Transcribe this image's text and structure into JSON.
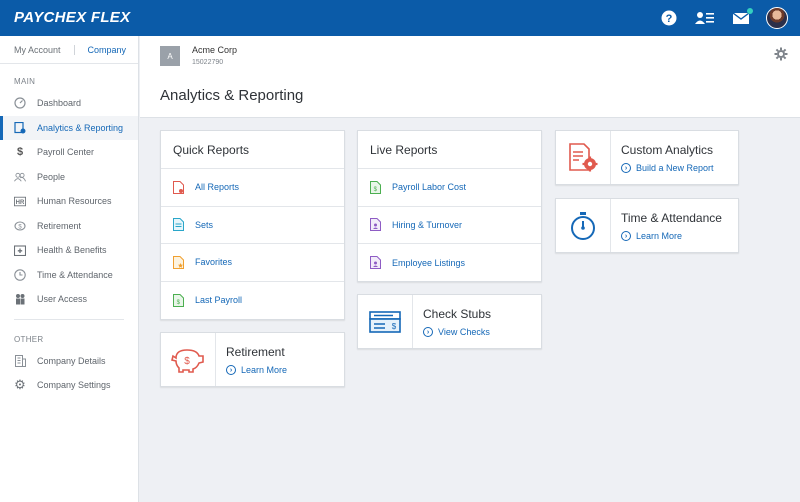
{
  "brand": "PAYCHEX FLEX",
  "topbar": {
    "icons": [
      "help-icon",
      "contacts-icon",
      "mail-icon",
      "avatar"
    ]
  },
  "sidebar": {
    "tabs": [
      {
        "label": "My Account"
      },
      {
        "label": "Company"
      }
    ],
    "main_heading": "MAIN",
    "main_items": [
      {
        "label": "Dashboard",
        "icon": "dashboard-icon"
      },
      {
        "label": "Analytics & Reporting",
        "icon": "report-icon"
      },
      {
        "label": "Payroll Center",
        "icon": "dollar-icon"
      },
      {
        "label": "People",
        "icon": "people-icon"
      },
      {
        "label": "Human Resources",
        "icon": "hr-icon"
      },
      {
        "label": "Retirement",
        "icon": "retirement-icon"
      },
      {
        "label": "Health & Benefits",
        "icon": "health-icon"
      },
      {
        "label": "Time & Attendance",
        "icon": "clock-icon"
      },
      {
        "label": "User Access",
        "icon": "user-access-icon"
      }
    ],
    "other_heading": "OTHER",
    "other_items": [
      {
        "label": "Company Details",
        "icon": "building-icon"
      },
      {
        "label": "Company Settings",
        "icon": "gear-icon"
      }
    ]
  },
  "company": {
    "badge": "A",
    "name": "Acme Corp",
    "id": "15022790"
  },
  "page_title": "Analytics & Reporting",
  "quick_reports": {
    "title": "Quick Reports",
    "links": [
      {
        "label": "All Reports"
      },
      {
        "label": "Sets"
      },
      {
        "label": "Favorites"
      },
      {
        "label": "Last Payroll"
      }
    ]
  },
  "live_reports": {
    "title": "Live Reports",
    "links": [
      {
        "label": "Payroll Labor Cost"
      },
      {
        "label": "Hiring & Turnover"
      },
      {
        "label": "Employee Listings"
      }
    ]
  },
  "retirement_card": {
    "title": "Retirement",
    "link": "Learn More"
  },
  "check_stubs_card": {
    "title": "Check Stubs",
    "link": "View Checks"
  },
  "custom_analytics_card": {
    "title": "Custom Analytics",
    "link": "Build a New Report"
  },
  "time_attendance_card": {
    "title": "Time & Attendance",
    "link": "Learn More"
  },
  "colors": {
    "brand_blue": "#0b5ba8",
    "link_blue": "#1568b7",
    "accent_red": "#e05a4e",
    "accent_green": "#4caf50",
    "accent_purple": "#8e5cc4",
    "accent_teal": "#2aa6c9",
    "accent_orange": "#f0a030"
  }
}
